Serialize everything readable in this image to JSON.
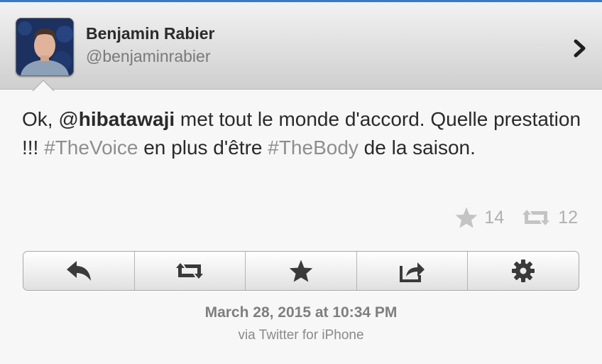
{
  "user": {
    "name": "Benjamin Rabier",
    "handle": "@benjaminrabier"
  },
  "tweet": {
    "t1": "Ok, ",
    "mention_at": "@",
    "mention_name": "hibatawaji",
    "t2": " met tout le monde d'accord. Quelle prestation !!! ",
    "hashtag1": "#TheVoice",
    "t3": " en plus d'être ",
    "hashtag2": "#TheBody",
    "t4": " de la saison."
  },
  "stats": {
    "favorites": "14",
    "retweets": "12"
  },
  "toolbar": {
    "icons": [
      "reply-icon",
      "retweet-icon",
      "favorite-icon",
      "share-icon",
      "settings-icon"
    ]
  },
  "meta": {
    "date": "March 28, 2015 at 10:34 PM",
    "via": "via Twitter for iPhone"
  },
  "colors": {
    "accent": "#3a78c8",
    "text": "#2a2a2a",
    "muted": "#8e8e8e"
  }
}
